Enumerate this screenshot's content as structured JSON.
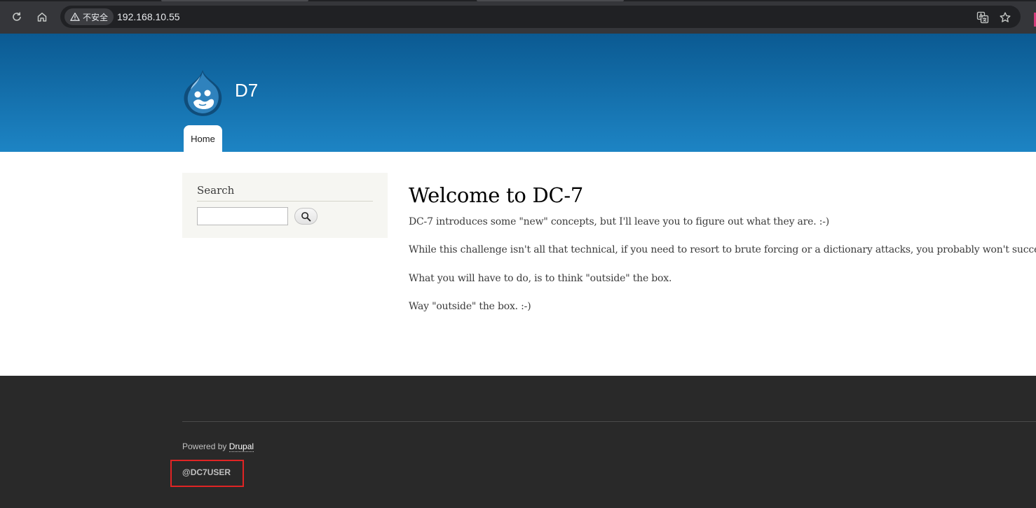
{
  "browser": {
    "security_label": "不安全",
    "url": "192.168.10.55"
  },
  "site": {
    "name": "D7",
    "nav": {
      "home_label": "Home"
    }
  },
  "sidebar": {
    "search_title": "Search",
    "search_input_value": ""
  },
  "main": {
    "title": "Welcome to DC-7",
    "paragraphs": [
      "DC-7 introduces some \"new\" concepts, but I'll leave you to figure out what they are.  :-)",
      "While this challenge isn't all that technical, if you need to resort to brute forcing or a dictionary attacks, you probably won't succeed.",
      "What you will have to do, is to think \"outside\" the box.",
      "Way \"outside\" the box.  :-)"
    ]
  },
  "footer": {
    "powered_prefix": "Powered by",
    "powered_link": "Drupal",
    "user_text": "@DC7USER"
  },
  "colors": {
    "header_top": "#0b5a92",
    "header_bottom": "#1d84c4",
    "footer_bg": "#292929",
    "annotation_box": "#e02424"
  },
  "icons": [
    "reload-icon",
    "home-icon",
    "warning-icon",
    "translate-icon",
    "star-icon",
    "drupal-logo",
    "search-icon"
  ]
}
